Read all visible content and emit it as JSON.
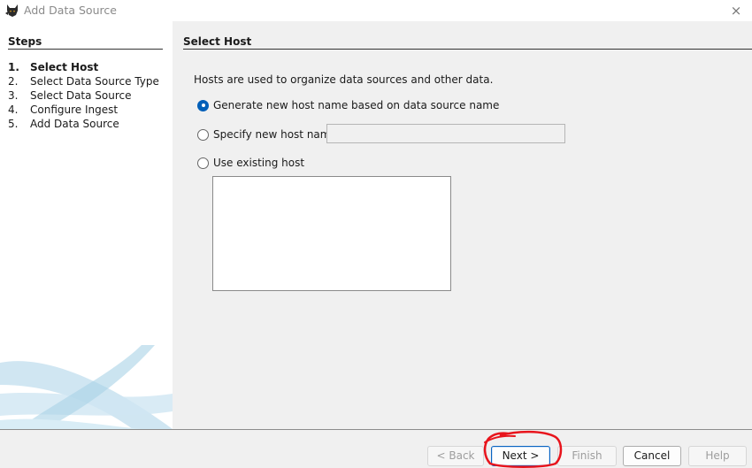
{
  "window": {
    "title": "Add Data Source",
    "close_icon": "×"
  },
  "steps": {
    "heading": "Steps",
    "items": [
      {
        "num": "1.",
        "label": "Select Host",
        "active": true
      },
      {
        "num": "2.",
        "label": "Select Data Source Type"
      },
      {
        "num": "3.",
        "label": "Select Data Source"
      },
      {
        "num": "4.",
        "label": "Configure Ingest"
      },
      {
        "num": "5.",
        "label": "Add Data Source"
      }
    ]
  },
  "panel": {
    "heading": "Select Host",
    "description": "Hosts are used to organize data sources and other data.",
    "options": {
      "generate": {
        "label": "Generate new host name based on data source name",
        "checked": true
      },
      "specify": {
        "label": "Specify new host name",
        "checked": false,
        "value": ""
      },
      "existing": {
        "label": "Use existing host",
        "checked": false
      }
    }
  },
  "footer": {
    "back": "< Back",
    "next": "Next >",
    "finish": "Finish",
    "cancel": "Cancel",
    "help": "Help"
  },
  "colors": {
    "accent": "#005fb8",
    "annotation": "#e8141c"
  }
}
